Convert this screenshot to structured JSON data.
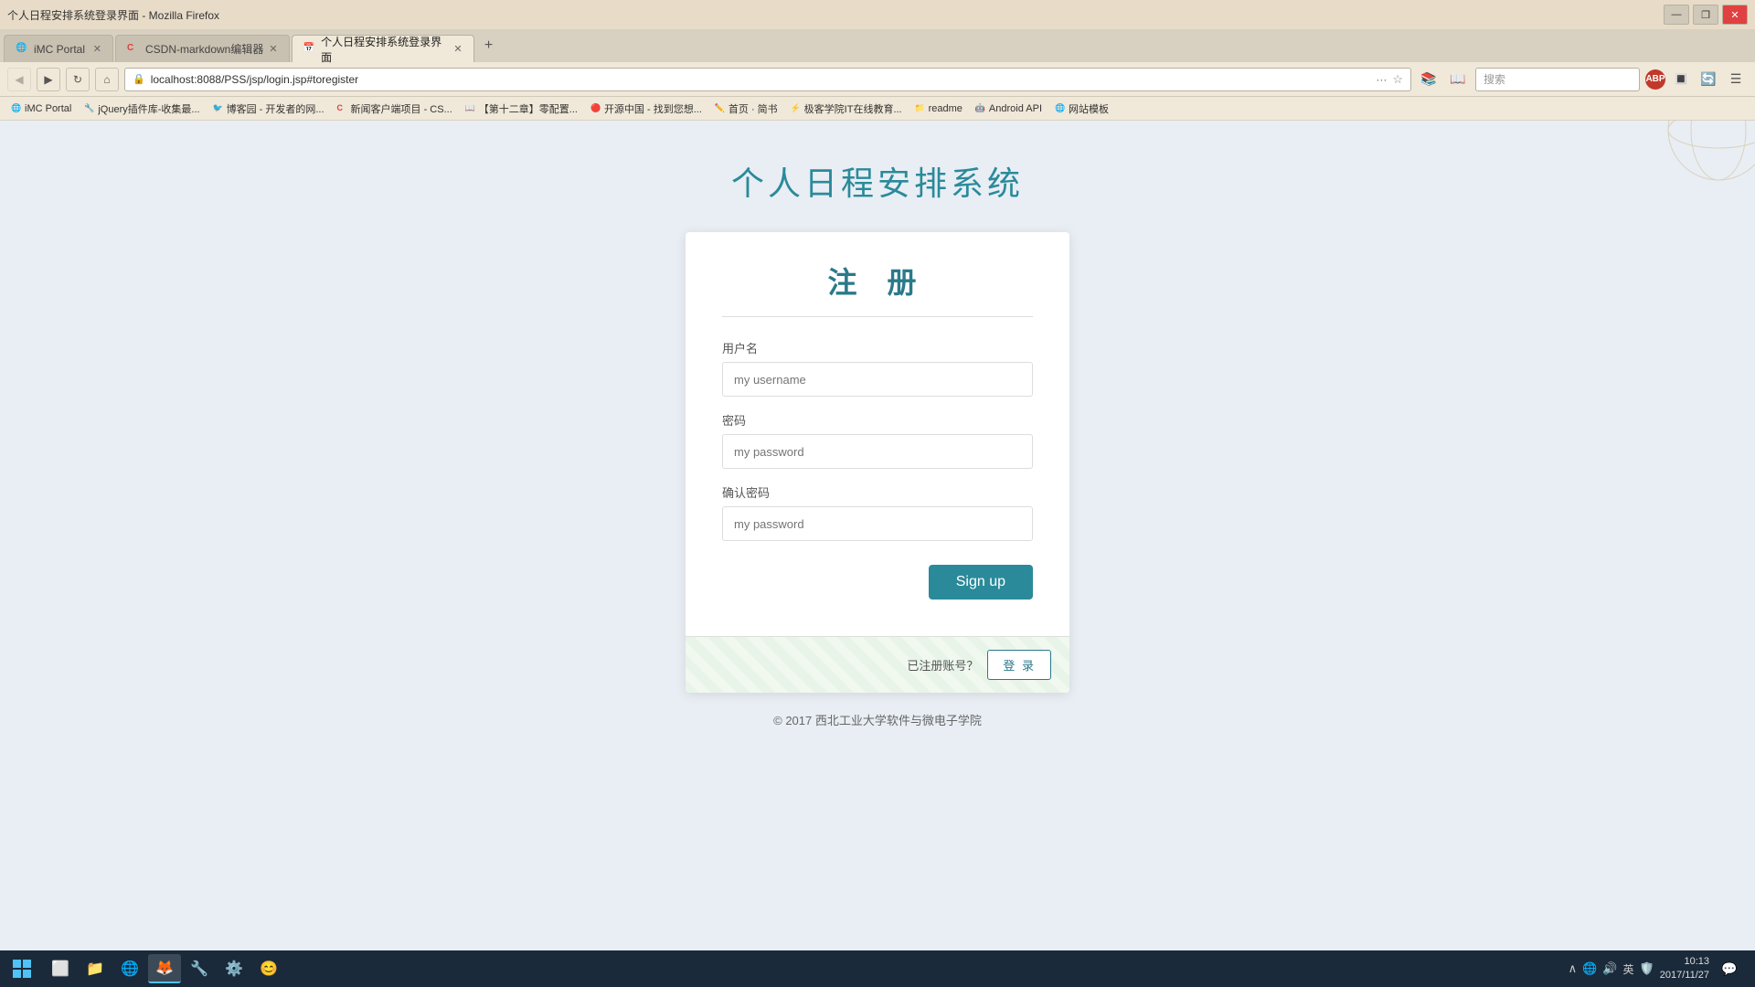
{
  "browser": {
    "title": "个人日程安排系统登录界面 - Mozilla Firefox",
    "tabs": [
      {
        "id": "tab1",
        "label": "iMC Portal",
        "favicon": "🌐",
        "active": false,
        "closeable": true
      },
      {
        "id": "tab2",
        "label": "CSDN-markdown编辑器",
        "favicon": "C",
        "active": false,
        "closeable": true
      },
      {
        "id": "tab3",
        "label": "个人日程安排系统登录界面",
        "favicon": "📅",
        "active": true,
        "closeable": true
      }
    ],
    "address": "localhost:8088/PSS/jsp/login.jsp#toregister",
    "search_placeholder": "搜索"
  },
  "bookmarks": [
    {
      "label": "iMC Portal",
      "favicon": "🌐"
    },
    {
      "label": "jQuery插件库-收集最...",
      "favicon": "🔧"
    },
    {
      "label": "博客园 - 开发者的网...",
      "favicon": "🐦"
    },
    {
      "label": "新闻客户端项目 - CS...",
      "favicon": "C"
    },
    {
      "label": "【第十二章】零配置...",
      "favicon": "📖"
    },
    {
      "label": "开源中国 - 找到您想...",
      "favicon": "🔴"
    },
    {
      "label": "首页 · 简书",
      "favicon": "✏️"
    },
    {
      "label": "极客学院IT在线教育...",
      "favicon": "⚡"
    },
    {
      "label": "readme",
      "favicon": "📁"
    },
    {
      "label": "Android API",
      "favicon": "🤖"
    },
    {
      "label": "网站模板",
      "favicon": "🌐"
    }
  ],
  "page": {
    "title": "个人日程安排系统",
    "footer": "© 2017 西北工业大学软件与微电子学院"
  },
  "form": {
    "card_title": "注  册",
    "username_label": "用户名",
    "username_placeholder": "my username",
    "password_label": "密码",
    "password_placeholder": "my password",
    "confirm_label": "确认密码",
    "confirm_placeholder": "my password",
    "signup_btn": "Sign up",
    "already_text": "已注册账号？",
    "login_btn": "登 录"
  },
  "taskbar": {
    "clock_time": "10:13",
    "clock_date": "2017/11/27",
    "lang": "英"
  }
}
